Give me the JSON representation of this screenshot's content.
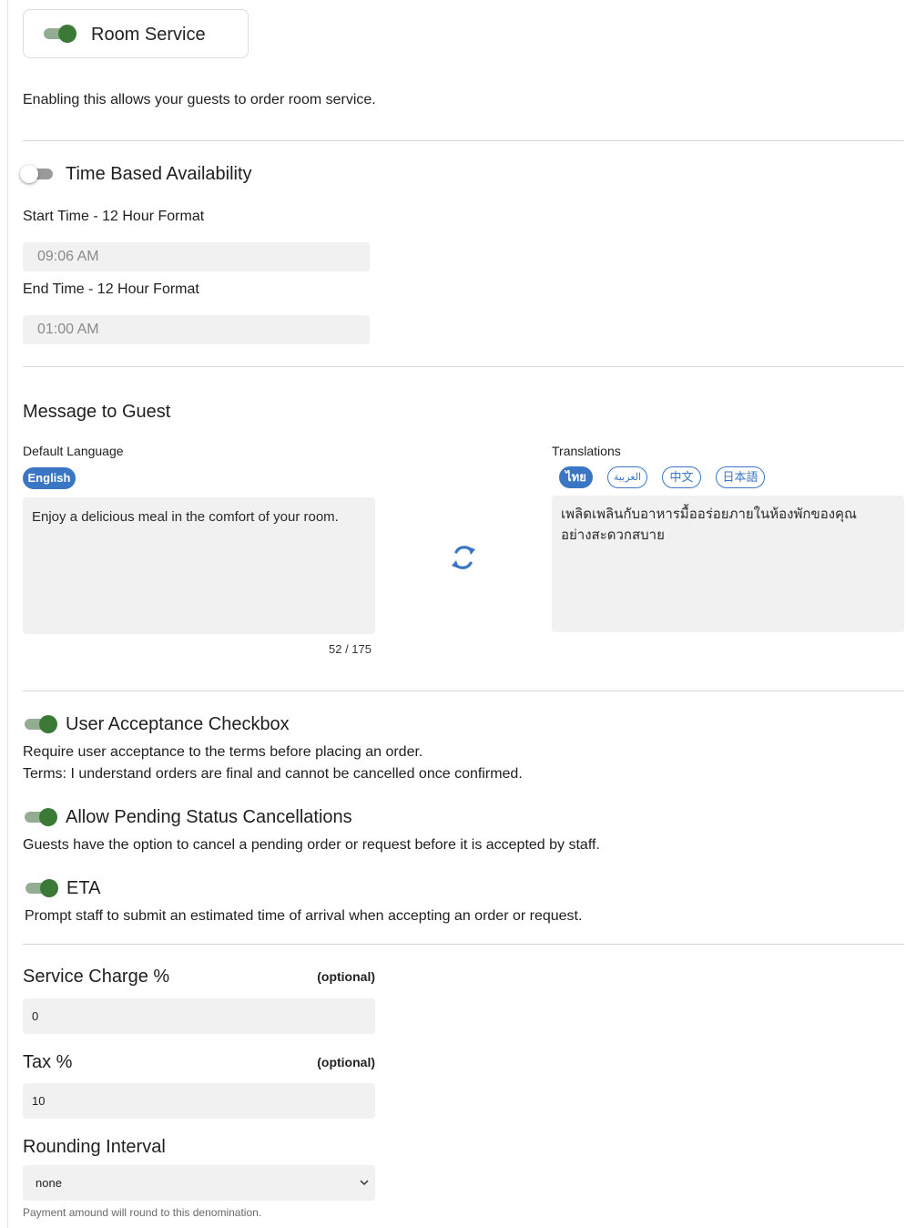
{
  "room_service": {
    "label": "Room Service",
    "enabled": true,
    "description": "Enabling this allows your guests to order room service."
  },
  "time_availability": {
    "label": "Time Based Availability",
    "enabled": false,
    "start_label": "Start Time - 12 Hour Format",
    "start_value": "09:06 AM",
    "end_label": "End Time - 12 Hour Format",
    "end_value": "01:00 AM"
  },
  "message": {
    "heading": "Message to Guest",
    "default_language_label": "Default Language",
    "default_language": "English",
    "default_text": "Enjoy a delicious meal in the comfort of your room.",
    "char_count": "52 / 175",
    "translations_label": "Translations",
    "translation_tabs": [
      "ไทย",
      "العربية",
      "中文",
      "日本語"
    ],
    "active_translation": "ไทย",
    "translation_text": "เพลิดเพลินกับอาหารมื้ออร่อยภายในห้องพักของคุณอย่างสะดวกสบาย",
    "sync_icon": "refresh-icon",
    "accent_color": "#3a76c4"
  },
  "options": {
    "user_acceptance": {
      "label": "User Acceptance Checkbox",
      "enabled": true,
      "description": "Require user acceptance to the terms before placing an order.",
      "terms": "Terms: I understand orders are final and cannot be cancelled once confirmed."
    },
    "pending_cancellations": {
      "label": "Allow Pending Status Cancellations",
      "enabled": true,
      "description": "Guests have the option to cancel a pending order or request before it is accepted by staff."
    },
    "eta": {
      "label": "ETA",
      "enabled": true,
      "description": "Prompt staff to submit an estimated time of arrival when accepting an order or request."
    }
  },
  "charges": {
    "service_charge_label": "Service Charge %",
    "service_charge_optional": "(optional)",
    "service_charge_value": "0",
    "tax_label": "Tax %",
    "tax_optional": "(optional)",
    "tax_value": "10",
    "rounding_label": "Rounding Interval",
    "rounding_value": "none",
    "rounding_help": "Payment amound will round to this denomination."
  },
  "colors": {
    "toggle_on": "#3a7a36",
    "toggle_on_track": "#93ad92",
    "input_bg": "#f1f1f1"
  }
}
